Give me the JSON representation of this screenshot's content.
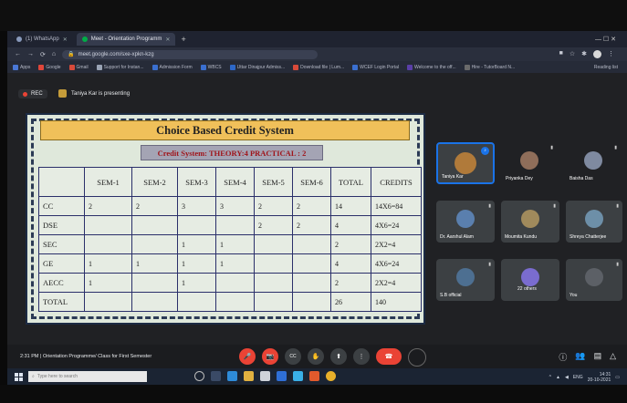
{
  "browser": {
    "tabs": [
      {
        "label": "(1) WhatsApp"
      },
      {
        "label": "Meet - Orientation Programm"
      }
    ],
    "new_tab": "+",
    "window_controls": "—   ☐   ✕",
    "url": "meet.google.com/sxe-xpkn-kzg",
    "bookmarks": [
      "Apps",
      "Google",
      "Gmail",
      "Support for Instan...",
      "Admission Form",
      "WBCS",
      "Uttar Dinajpur Admiss...",
      "Download file | Lum...",
      "WCEF Login Portal",
      "Welcome to the off...",
      "Hire - TutorBoard N..."
    ],
    "bookmarks_right": "Reading list"
  },
  "meet": {
    "rec_label": "REC",
    "presenting_text": "Taniya Kar is presenting",
    "slide": {
      "title": "Choice Based Credit System",
      "subtitle": "Credit System: THEORY:4 PRACTICAL : 2",
      "headers": [
        "",
        "SEM-1",
        "SEM-2",
        "SEM-3",
        "SEM-4",
        "SEM-5",
        "SEM-6",
        "TOTAL",
        "CREDITS"
      ],
      "rows": [
        [
          "CC",
          "2",
          "2",
          "3",
          "3",
          "2",
          "2",
          "14",
          "14X6=84"
        ],
        [
          "DSE",
          "",
          "",
          "",
          "",
          "2",
          "2",
          "4",
          "4X6=24"
        ],
        [
          "SEC",
          "",
          "",
          "1",
          "1",
          "",
          "",
          "2",
          "2X2=4"
        ],
        [
          "GE",
          "1",
          "1",
          "1",
          "1",
          "",
          "",
          "4",
          "4X6=24"
        ],
        [
          "AECC",
          "1",
          "",
          "1",
          "",
          "",
          "",
          "2",
          "2X2=4"
        ],
        [
          "TOTAL",
          "",
          "",
          "",
          "",
          "",
          "",
          "26",
          "140"
        ]
      ]
    },
    "participants": [
      {
        "name": "Taniya Kar",
        "speaking": true
      },
      {
        "name": "Priyanka Dey"
      },
      {
        "name": "Baisha Das"
      },
      {
        "name": "Dr. Aarshul Alam"
      },
      {
        "name": "Moumita Kundu"
      },
      {
        "name": "Shreya Chatterjee"
      },
      {
        "name": "S.B official"
      },
      {
        "name": "22 others"
      },
      {
        "name": "You"
      }
    ],
    "meeting_info": "2:31 PM  |  Orientation Programme/ Class for First Semester",
    "controls": {
      "mic": "🎤",
      "cam": "📷",
      "cc": "CC",
      "hand": "✋",
      "present": "⬆",
      "more": "⋮",
      "end": "☎"
    }
  },
  "taskbar": {
    "search_placeholder": "Type here to search",
    "time": "14:31",
    "date": "20-10-2021",
    "lang": "ENG"
  },
  "colors": {
    "accent_blue": "#1a73e8",
    "end_call_red": "#ea4335",
    "slide_title_bg": "#f0c05a",
    "slide_subtitle_text": "#a0141a"
  }
}
